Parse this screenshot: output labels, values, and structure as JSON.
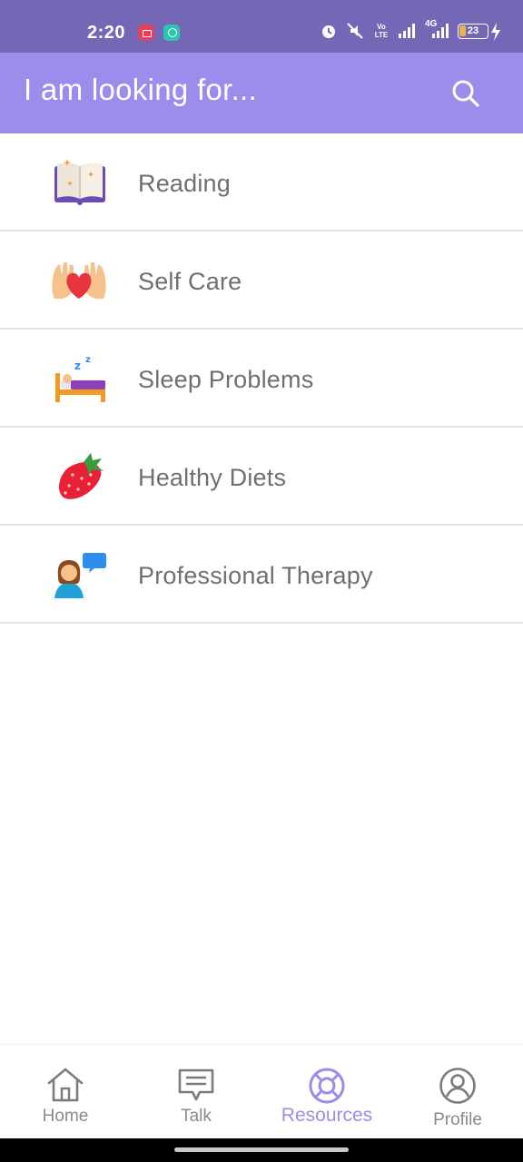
{
  "status_bar": {
    "time": "2:20",
    "net_label": "4G",
    "volte_label": "Vo LTE",
    "battery": "23"
  },
  "header": {
    "title": "I am looking for...",
    "search_icon": "search-icon"
  },
  "categories": [
    {
      "label": "Reading",
      "icon": "open-book-icon"
    },
    {
      "label": "Self Care",
      "icon": "hands-heart-icon"
    },
    {
      "label": "Sleep Problems",
      "icon": "sleeping-bed-icon"
    },
    {
      "label": "Healthy Diets",
      "icon": "strawberry-icon"
    },
    {
      "label": "Professional Therapy",
      "icon": "therapist-icon"
    }
  ],
  "bottom_nav": [
    {
      "label": "Home",
      "icon": "home-icon",
      "active": false
    },
    {
      "label": "Talk",
      "icon": "chat-icon",
      "active": false
    },
    {
      "label": "Resources",
      "icon": "lifebuoy-icon",
      "active": true
    },
    {
      "label": "Profile",
      "icon": "profile-icon",
      "active": false
    }
  ],
  "colors": {
    "status_bar": "#7467b6",
    "header": "#9d8cec",
    "accent": "#9d8cec",
    "text": "#6f6f73",
    "divider": "#e1e1e6"
  }
}
